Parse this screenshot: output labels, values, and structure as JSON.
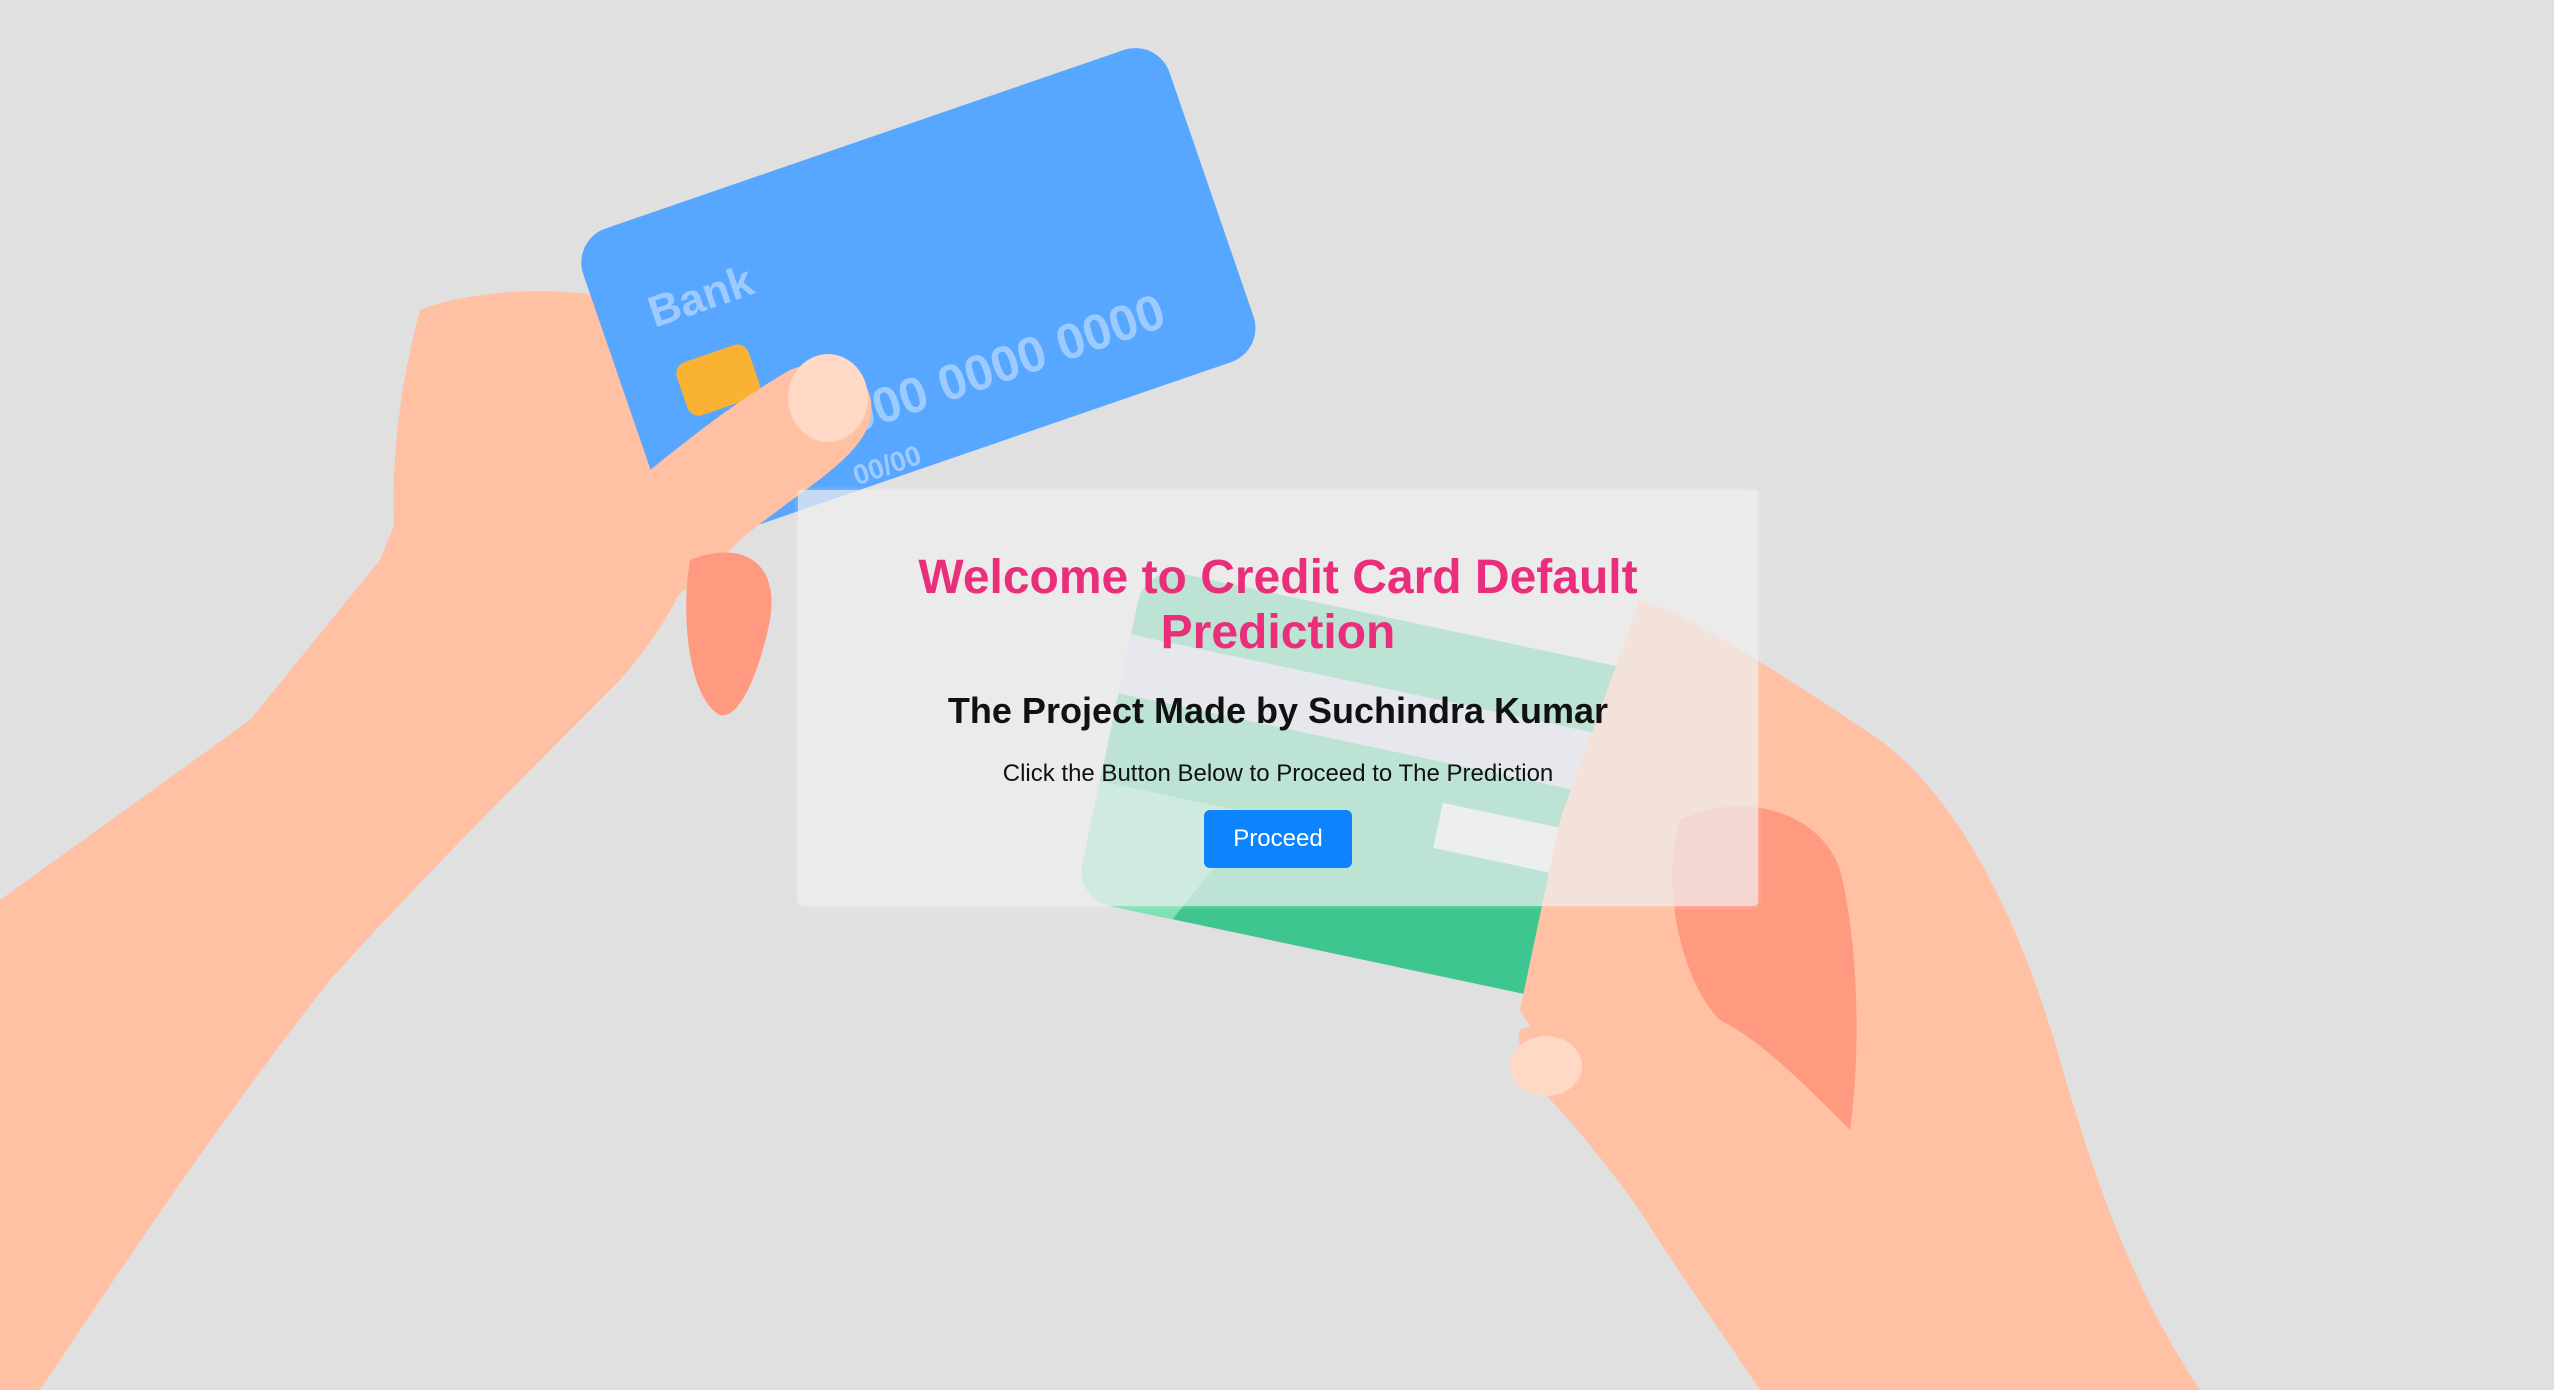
{
  "background": {
    "card_front": {
      "bank_label": "Bank",
      "card_number": "0000 0000 0000 0000",
      "expiry": "00/00"
    },
    "colors": {
      "page": "#e0e0e0",
      "skin": "#ffc0a4",
      "skin_shadow": "#ff9a80",
      "card_blue": "#57a6ff",
      "card_green": "#3fc58f",
      "chip": "#f9b233"
    }
  },
  "welcome": {
    "title": "Welcome to Credit Card Default Prediction",
    "subtitle": "The Project Made by Suchindra Kumar",
    "instruction": "Click the Button Below to Proceed to The Prediction",
    "proceed_label": "Proceed"
  },
  "colors": {
    "title": "#ea2e7c",
    "button": "#0d84fb",
    "button_text": "#ffffff"
  }
}
